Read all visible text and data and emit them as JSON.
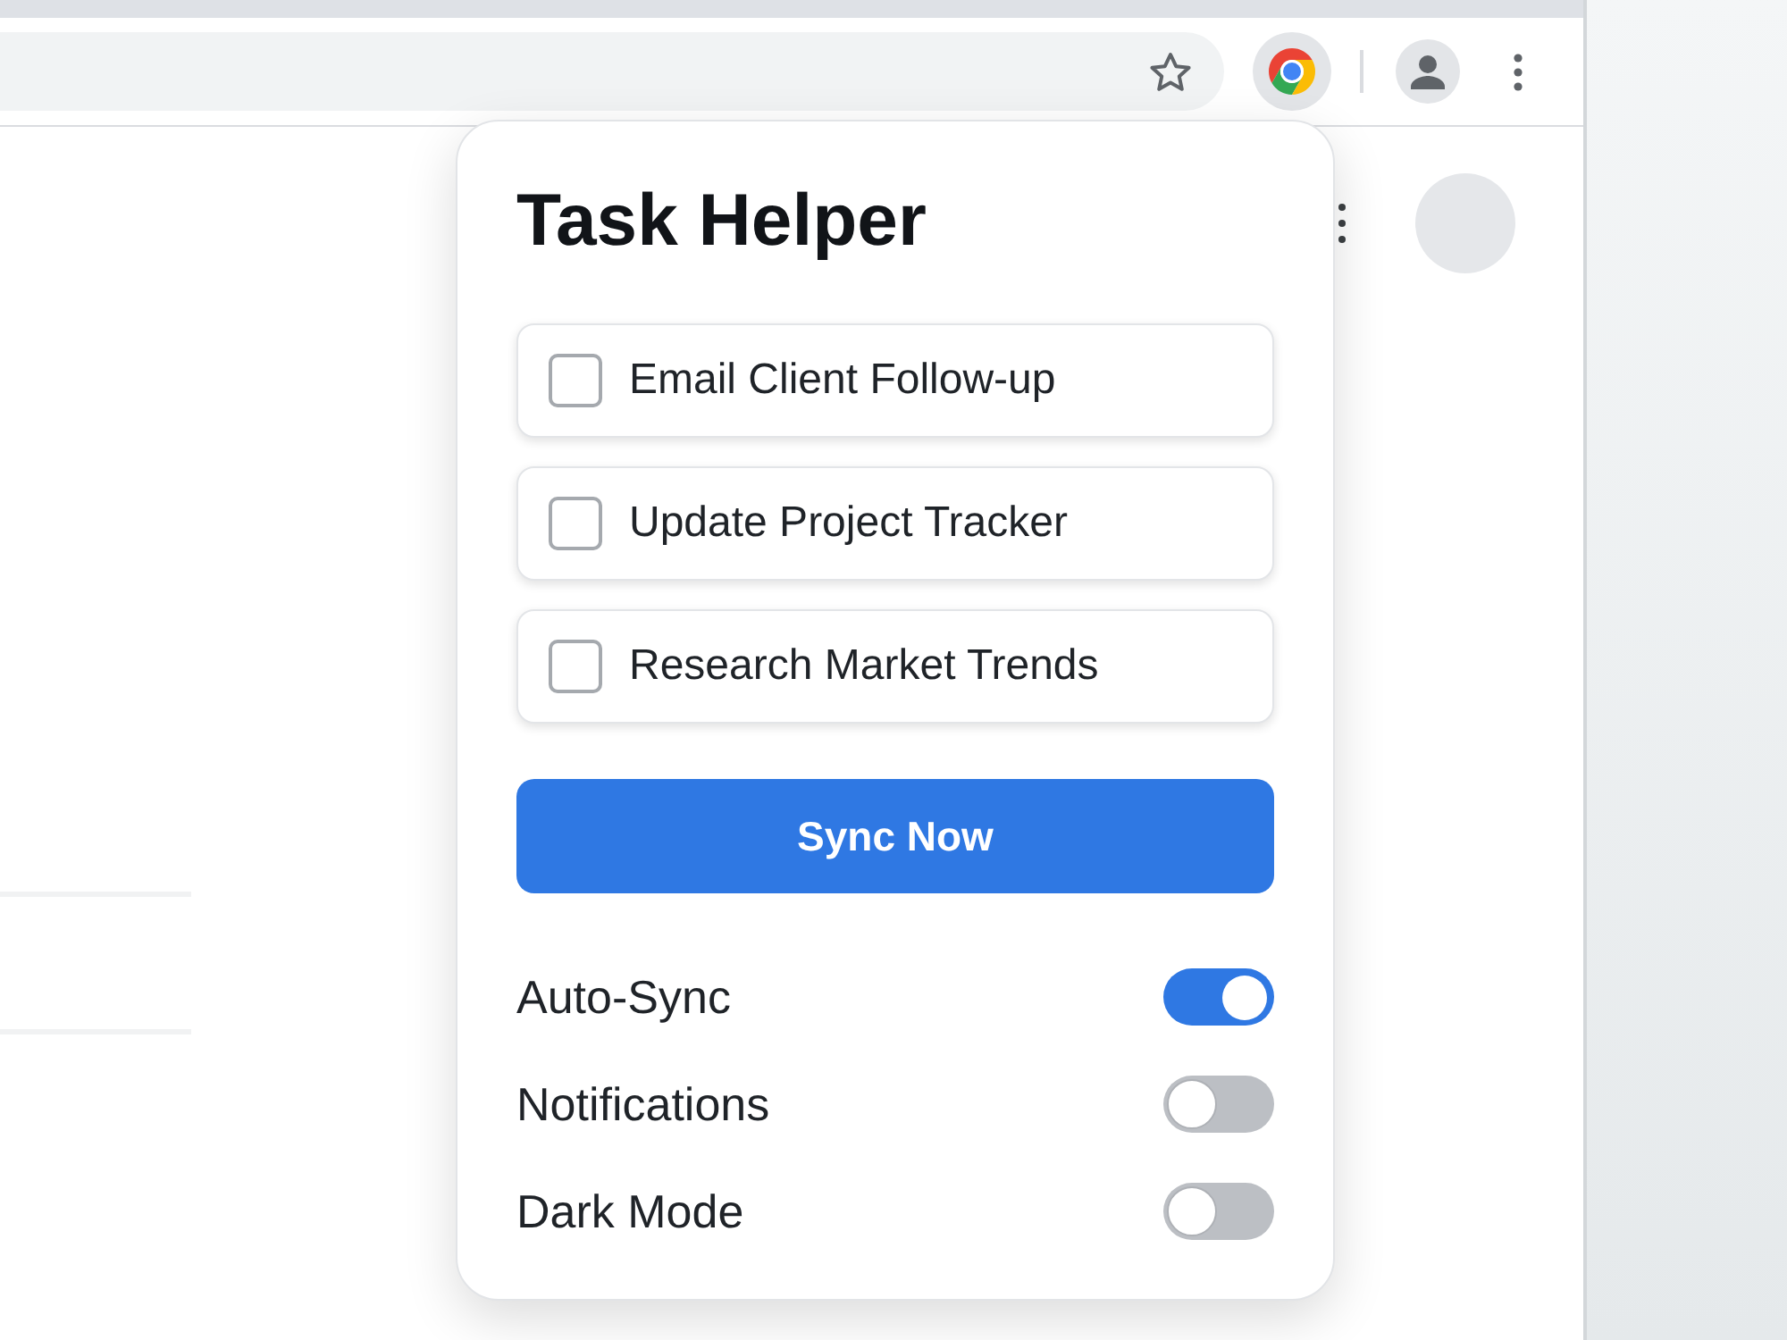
{
  "popup": {
    "title": "Task Helper",
    "tasks": [
      {
        "label": "Email Client Follow-up",
        "checked": false
      },
      {
        "label": "Update Project Tracker",
        "checked": false
      },
      {
        "label": "Research Market Trends",
        "checked": false
      }
    ],
    "sync_button": "Sync Now",
    "settings": [
      {
        "label": "Auto-Sync",
        "on": true
      },
      {
        "label": "Notifications",
        "on": false
      },
      {
        "label": "Dark Mode",
        "on": false
      }
    ]
  }
}
